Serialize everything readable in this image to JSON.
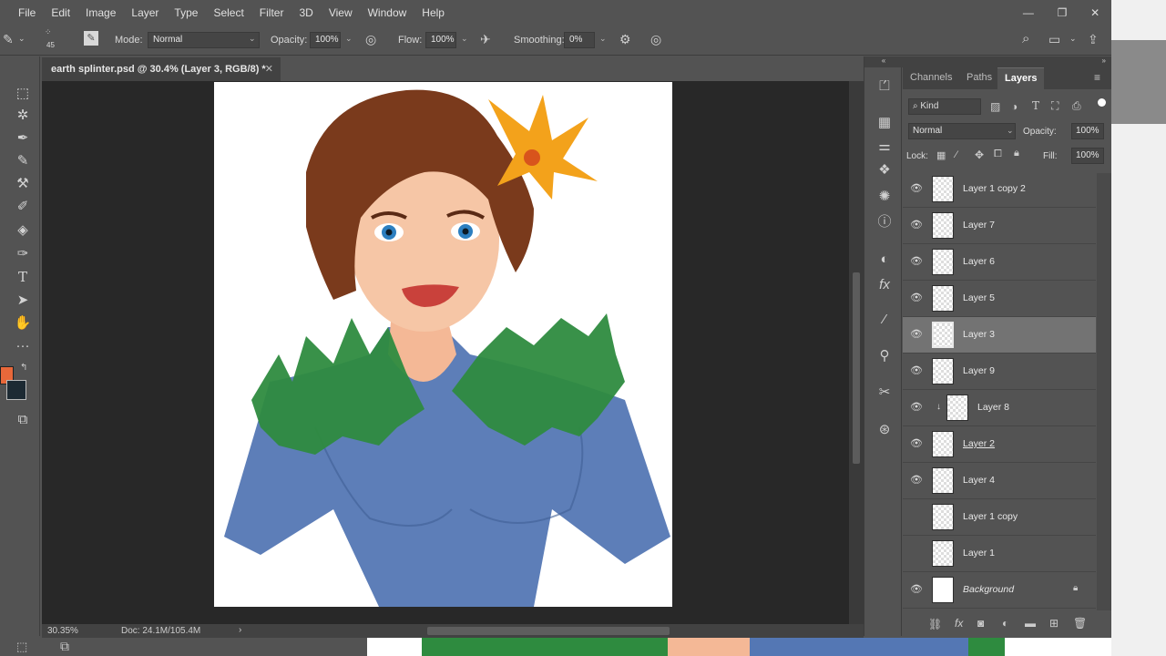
{
  "menu": [
    "File",
    "Edit",
    "Image",
    "Layer",
    "Type",
    "Select",
    "Filter",
    "3D",
    "View",
    "Window",
    "Help"
  ],
  "window_controls": {
    "minimize": "—",
    "restore": "❐",
    "close": "✕"
  },
  "options": {
    "brush_size": "45",
    "mode_label": "Mode:",
    "mode_value": "Normal",
    "opacity_label": "Opacity:",
    "opacity_value": "100%",
    "flow_label": "Flow:",
    "flow_value": "100%",
    "smoothing_label": "Smoothing:",
    "smoothing_value": "0%"
  },
  "document": {
    "tab_title": "earth splinter.psd @ 30.4% (Layer 3, RGB/8) *",
    "close": "✕"
  },
  "status": {
    "zoom": "30.35%",
    "doc_info": "Doc: 24.1M/105.4M",
    "arrow": "›"
  },
  "colors": {
    "foreground": "#e8683a",
    "background": "#1d2a33"
  },
  "panel": {
    "tabs": [
      "Channels",
      "Paths",
      "Layers"
    ],
    "active_tab": "Layers",
    "filter_kind": "Kind",
    "blend_mode": "Normal",
    "opacity_label": "Opacity:",
    "opacity_value": "100%",
    "lock_label": "Lock:",
    "fill_label": "Fill:",
    "fill_value": "100%"
  },
  "layers": [
    {
      "name": "Layer 1 copy 2",
      "visible": true,
      "selected": false
    },
    {
      "name": "Layer 7",
      "visible": true,
      "selected": false
    },
    {
      "name": "Layer 6",
      "visible": true,
      "selected": false
    },
    {
      "name": "Layer 5",
      "visible": true,
      "selected": false
    },
    {
      "name": "Layer 3",
      "visible": true,
      "selected": true
    },
    {
      "name": "Layer 9",
      "visible": true,
      "selected": false
    },
    {
      "name": "Layer 8",
      "visible": true,
      "selected": false,
      "clipped": true
    },
    {
      "name": "Layer 2",
      "visible": true,
      "selected": false
    },
    {
      "name": "Layer 4",
      "visible": true,
      "selected": false
    },
    {
      "name": "Layer 1 copy",
      "visible": false,
      "selected": false
    },
    {
      "name": "Layer 1",
      "visible": false,
      "selected": false
    },
    {
      "name": "Background",
      "visible": true,
      "selected": false,
      "locked": true
    }
  ]
}
